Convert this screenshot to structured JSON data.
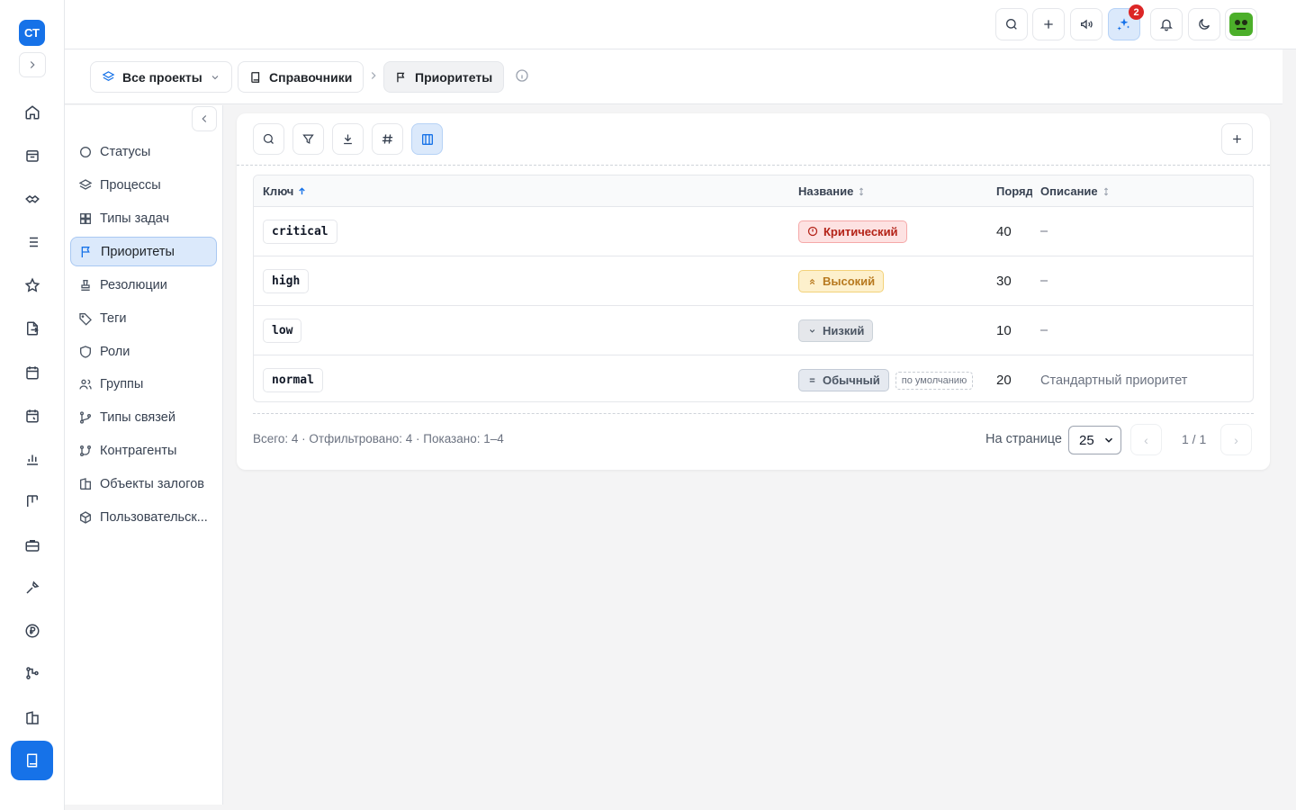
{
  "rail": {
    "logo": "СТ",
    "icons": [
      "home-icon",
      "inbox-icon",
      "handshake-icon",
      "list-icon",
      "star-icon",
      "document-export-icon",
      "calendar-icon",
      "calendar-clock-icon",
      "bar-chart-icon",
      "kanban-icon",
      "briefcase-icon",
      "tools-icon",
      "ruble-icon",
      "org-chart-icon",
      "building-icon",
      "book-icon"
    ]
  },
  "topbar": {
    "notification_badge": "2"
  },
  "breadcrumb": {
    "projects": "Все проекты",
    "directories": "Справочники",
    "current": "Приоритеты"
  },
  "sidebar": {
    "items": [
      {
        "label": "Статусы",
        "icon": "circle-icon"
      },
      {
        "label": "Процессы",
        "icon": "layers-icon"
      },
      {
        "label": "Типы задач",
        "icon": "grid-icon"
      },
      {
        "label": "Приоритеты",
        "icon": "flag-icon",
        "active": true
      },
      {
        "label": "Резолюции",
        "icon": "stamp-icon"
      },
      {
        "label": "Теги",
        "icon": "tag-icon"
      },
      {
        "label": "Роли",
        "icon": "shield-icon"
      },
      {
        "label": "Группы",
        "icon": "users-icon"
      },
      {
        "label": "Типы связей",
        "icon": "git-branch-icon"
      },
      {
        "label": "Контрагенты",
        "icon": "network-icon"
      },
      {
        "label": "Объекты залогов",
        "icon": "building-icon"
      },
      {
        "label": "Пользовательск...",
        "icon": "cube-icon"
      }
    ]
  },
  "table": {
    "headers": {
      "key": "Ключ",
      "name": "Название",
      "order": "Поряд",
      "description": "Описание"
    },
    "rows": [
      {
        "key": "critical",
        "name": "Критический",
        "variant": "red",
        "icon": "alert-circle-icon",
        "order": "40",
        "description": "–",
        "default_tag": ""
      },
      {
        "key": "high",
        "name": "Высокий",
        "variant": "amber",
        "icon": "chevrons-up-icon",
        "order": "30",
        "description": "–",
        "default_tag": ""
      },
      {
        "key": "low",
        "name": "Низкий",
        "variant": "slate",
        "icon": "chevron-down-icon",
        "order": "10",
        "description": "–",
        "default_tag": ""
      },
      {
        "key": "normal",
        "name": "Обычный",
        "variant": "blue",
        "icon": "equals-icon",
        "order": "20",
        "description": "Стандартный приоритет",
        "default_tag": "по умолчанию"
      }
    ]
  },
  "footer": {
    "summary": "Всего: 4 · Отфильтровано: 4 · Показано: 1–4",
    "per_page_label": "На странице",
    "per_page_value": "25",
    "page_info": "1 / 1",
    "prev": "‹",
    "next": "›"
  },
  "colors": {
    "accent": "#1672e8",
    "critical": "#b42318",
    "high": "#b7791f"
  }
}
